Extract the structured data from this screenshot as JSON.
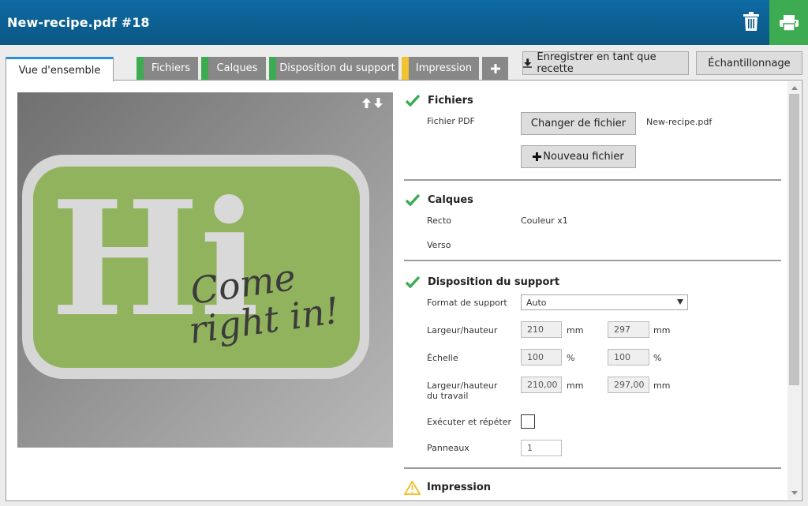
{
  "header": {
    "title": "New-recipe.pdf #18"
  },
  "tabs": [
    {
      "label": "Vue d'ensemble",
      "active": true
    },
    {
      "label": "Fichiers",
      "status_color": "#3cab51"
    },
    {
      "label": "Calques",
      "status_color": "#3cab51"
    },
    {
      "label": "Disposition du support",
      "status_color": "#3cab51"
    },
    {
      "label": "Impression",
      "status_color": "#f2c230"
    }
  ],
  "toolbar": {
    "save_recipe_label": "Enregistrer en tant que recette",
    "sampling_label": "Échantillonnage"
  },
  "preview": {
    "big_text": "Hi",
    "script_line1": "Come",
    "script_line2": "right in!"
  },
  "sections": {
    "fichiers": {
      "title": "Fichiers",
      "pdf_label": "Fichier PDF",
      "change_file_label": "Changer de fichier",
      "file_name": "New-recipe.pdf",
      "new_file_label": "Nouveau fichier"
    },
    "calques": {
      "title": "Calques",
      "recto_label": "Recto",
      "recto_value": "Couleur x1",
      "verso_label": "Verso"
    },
    "disposition": {
      "title": "Disposition du support",
      "format_label": "Format de support",
      "format_value": "Auto",
      "size_label": "Largeur/hauteur",
      "width": "210",
      "height": "297",
      "unit_mm": "mm",
      "scale_label": "Échelle",
      "scale_x": "100",
      "scale_y": "100",
      "unit_pct": "%",
      "job_label_1": "Largeur/hauteur",
      "job_label_2": "du travail",
      "job_width": "210,00",
      "job_height": "297,00",
      "step_repeat_label": "Exécuter et répéter",
      "panels_label": "Panneaux",
      "panels_value": "1"
    },
    "impression": {
      "title": "Impression"
    }
  },
  "colors": {
    "header": "#0b5784",
    "print_button": "#3cab51",
    "ok_check": "#3cab51",
    "warning": "#f2c230",
    "preview_green": "#92b35e"
  },
  "icons": {
    "trash": "trash-icon",
    "print": "printer-icon",
    "download": "download-icon",
    "plus": "plus-icon",
    "check": "check-icon",
    "warning": "warning-icon"
  }
}
